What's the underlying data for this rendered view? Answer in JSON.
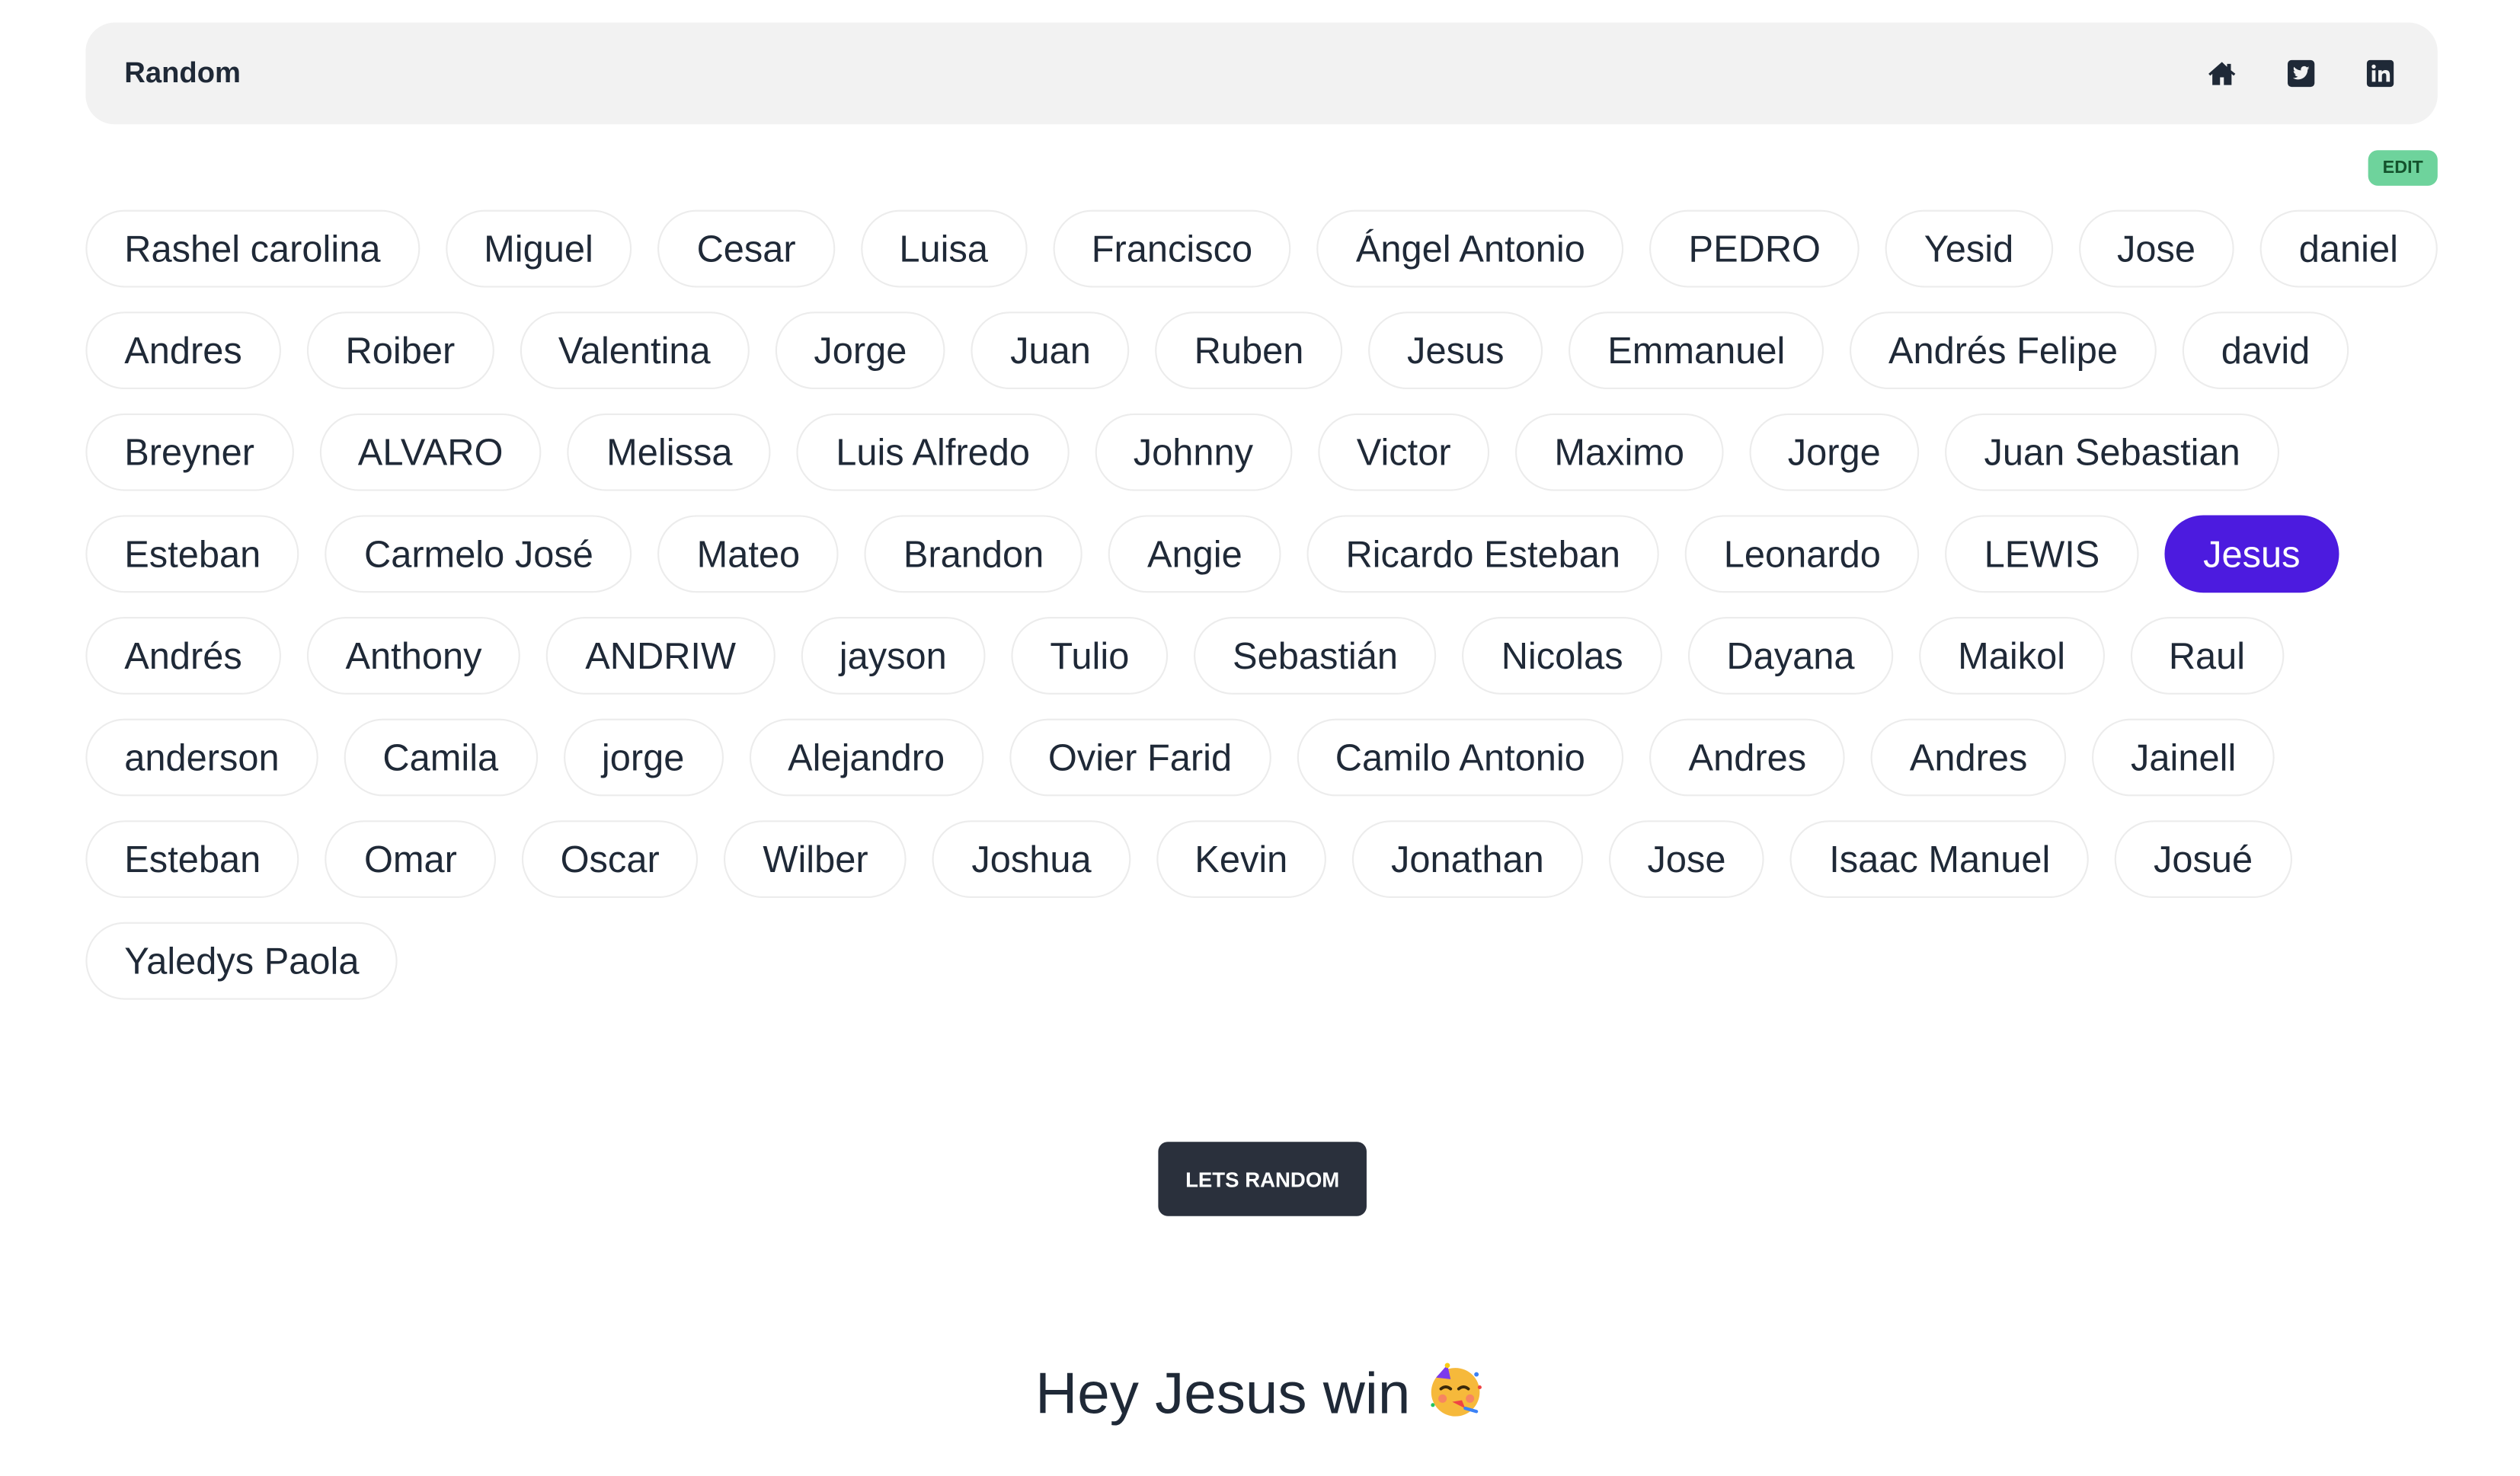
{
  "header": {
    "title": "Random",
    "icons": [
      "home-icon",
      "twitter-icon",
      "linkedin-icon"
    ]
  },
  "edit_label": "EDIT",
  "names": [
    "Rashel carolina",
    "Miguel",
    "Cesar",
    "Luisa",
    "Francisco",
    "Ángel Antonio",
    "PEDRO",
    "Yesid",
    "Jose",
    "daniel",
    "Andres",
    "Roiber",
    "Valentina",
    "Jorge",
    "Juan",
    "Ruben",
    "Jesus",
    "Emmanuel",
    "Andrés Felipe",
    "david",
    "Breyner",
    "ALVARO",
    "Melissa",
    "Luis Alfredo",
    "Johnny",
    "Victor",
    "Maximo",
    "Jorge",
    "Juan Sebastian",
    "Esteban",
    "Carmelo José",
    "Mateo",
    "Brandon",
    "Angie",
    "Ricardo Esteban",
    "Leonardo",
    "LEWIS",
    "Jesus",
    "Andrés",
    "Anthony",
    "ANDRIW",
    "jayson",
    "Tulio",
    "Sebastián",
    "Nicolas",
    "Dayana",
    "Maikol",
    "Raul",
    "anderson",
    "Camila",
    "jorge",
    "Alejandro",
    "Ovier Farid",
    "Camilo Antonio",
    "Andres",
    "Andres",
    "Jainell",
    "Esteban",
    "Omar",
    "Oscar",
    "Wilber",
    "Joshua",
    "Kevin",
    "Jonathan",
    "Jose",
    "Isaac Manuel",
    "Josué",
    "Yaledys Paola"
  ],
  "selected_index": 37,
  "random_button_label": "LETS RANDOM",
  "winner_text": "Hey Jesus win",
  "winner_emoji": "partying-face-emoji",
  "colors": {
    "selected_chip": "#4c1bdf",
    "edit_button": "#6ed39c",
    "random_button": "#2a303c",
    "navbar_bg": "#f2f2f2"
  }
}
